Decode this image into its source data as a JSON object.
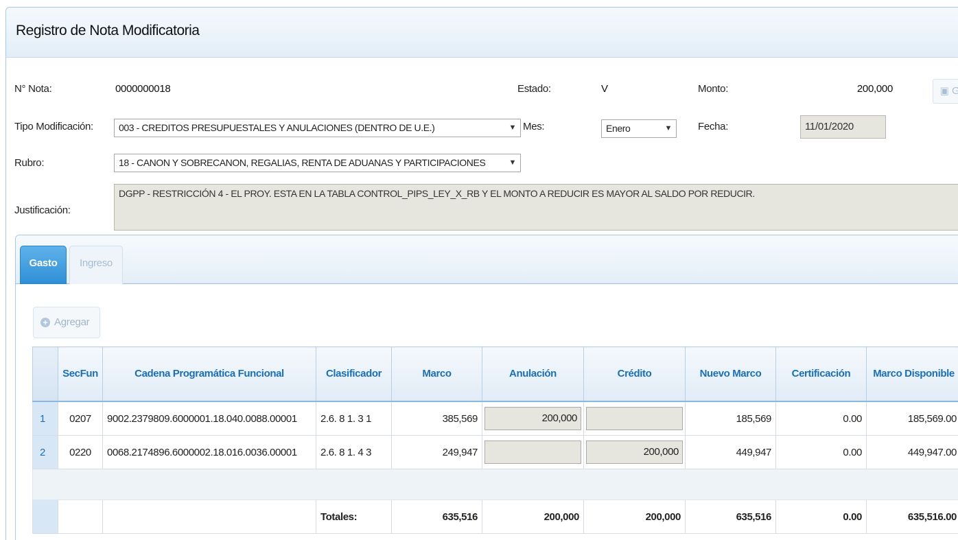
{
  "window": {
    "title": "Registro de Nota Modificatoria"
  },
  "form": {
    "nota_label": "N° Nota:",
    "nota_value": "0000000018",
    "estado_label": "Estado:",
    "estado_value": "V",
    "monto_label": "Monto:",
    "monto_value": "200,000",
    "grabar_label": "Gra",
    "tipo_label": "Tipo Modificación:",
    "tipo_value": "003 - CREDITOS PRESUPUESTALES Y ANULACIONES (DENTRO DE U.E.)",
    "mes_label": "Mes:",
    "mes_value": "Enero",
    "fecha_label": "Fecha:",
    "fecha_value": "11/01/2020",
    "rubro_label": "Rubro:",
    "rubro_value": "18 - CANON Y SOBRECANON, REGALIAS, RENTA DE ADUANAS Y PARTICIPACIONES",
    "justificacion_label": "Justificación:",
    "justificacion_value": "DGPP - RESTRICCIÓN 4 - EL PROY. ESTA EN LA TABLA CONTROL_PIPS_LEY_X_RB Y EL MONTO A REDUCIR ES MAYOR AL SALDO POR REDUCIR."
  },
  "tabs": [
    {
      "label": "Gasto",
      "active": true
    },
    {
      "label": "Ingreso",
      "active": false
    }
  ],
  "toolbar": {
    "agregar_label": "Agregar"
  },
  "grid": {
    "headers": {
      "secfun": "SecFun",
      "cadena": "Cadena Programática Funcional",
      "clasificador": "Clasificador",
      "marco": "Marco",
      "anulacion": "Anulación",
      "credito": "Crédito",
      "nuevo_marco": "Nuevo Marco",
      "certificacion": "Certificación",
      "marco_disponible": "Marco Disponible"
    },
    "rows": [
      {
        "n": "1",
        "secfun": "0207",
        "cadena": "9002.2379809.6000001.18.040.0088.00001",
        "clasificador": "2.6. 8 1. 3 1",
        "marco": "385,569",
        "anulacion": "200,000",
        "credito": "",
        "nuevo_marco": "185,569",
        "certificacion": "0.00",
        "marco_disponible": "185,569.00"
      },
      {
        "n": "2",
        "secfun": "0220",
        "cadena": "0068.2174896.6000002.18.016.0036.00001",
        "clasificador": "2.6. 8 1. 4 3",
        "marco": "249,947",
        "anulacion": "",
        "credito": "200,000",
        "nuevo_marco": "449,947",
        "certificacion": "0.00",
        "marco_disponible": "449,947.00"
      }
    ],
    "totals": {
      "label": "Totales:",
      "marco": "635,516",
      "anulacion": "200,000",
      "credito": "200,000",
      "nuevo_marco": "635,516",
      "certificacion": "0.00",
      "marco_disponible": "635,516.00"
    }
  }
}
